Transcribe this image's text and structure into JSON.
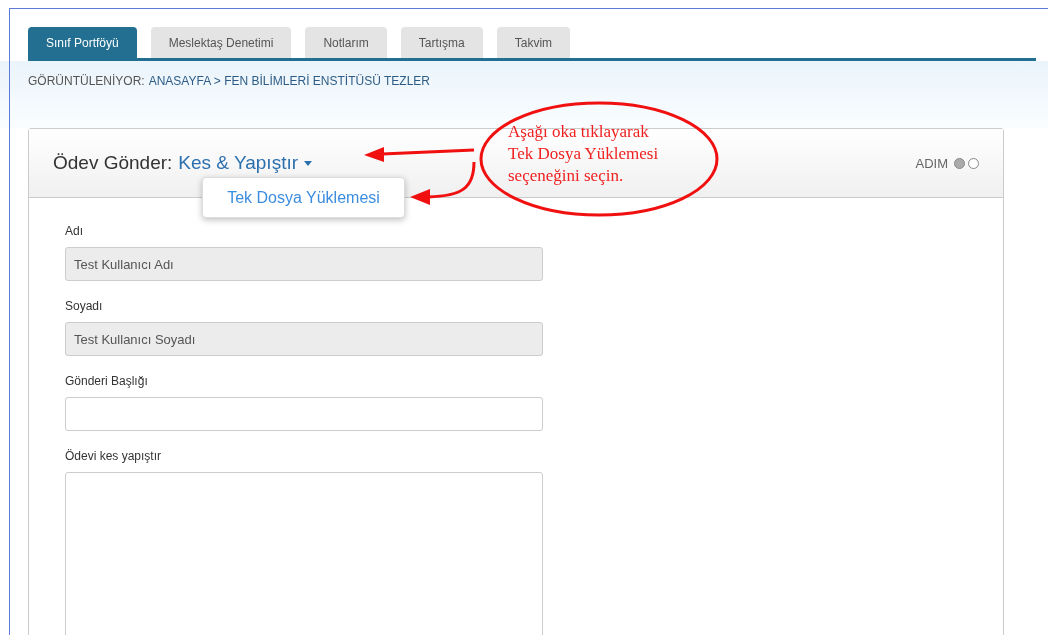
{
  "tabs": [
    {
      "label": "Sınıf Portföyü",
      "selected": true
    },
    {
      "label": "Meslektaş Denetimi",
      "selected": false
    },
    {
      "label": "Notlarım",
      "selected": false
    },
    {
      "label": "Tartışma",
      "selected": false
    },
    {
      "label": "Takvim",
      "selected": false
    }
  ],
  "breadcrumb": {
    "label": "GÖRÜNTÜLENİYOR:",
    "path": "ANASAYFA > FEN BİLİMLERİ ENSTİTÜSÜ TEZLER"
  },
  "card": {
    "title": "Ödev Gönder:",
    "mode": "Kes & Yapıştır",
    "dropdown_item": "Tek Dosya Yüklemesi",
    "step_label": "ADIM",
    "steps": [
      {
        "selected": true
      },
      {
        "selected": false
      }
    ]
  },
  "fields": [
    {
      "label": "Adı",
      "kind": "input",
      "value": "Test Kullanıcı Adı",
      "disabled": true
    },
    {
      "label": "Soyadı",
      "kind": "input",
      "value": "Test Kullanıcı Soyadı",
      "disabled": true
    },
    {
      "label": "Gönderi Başlığı",
      "kind": "input",
      "disabled": false
    },
    {
      "label": "Ödevi kes yapıştır",
      "kind": "textarea",
      "disabled": false
    }
  ],
  "annotation": {
    "lines": [
      "Aşağı oka tıklayarak",
      "Tek Dosya Yüklemesi",
      "seçeneğini seçin."
    ]
  }
}
